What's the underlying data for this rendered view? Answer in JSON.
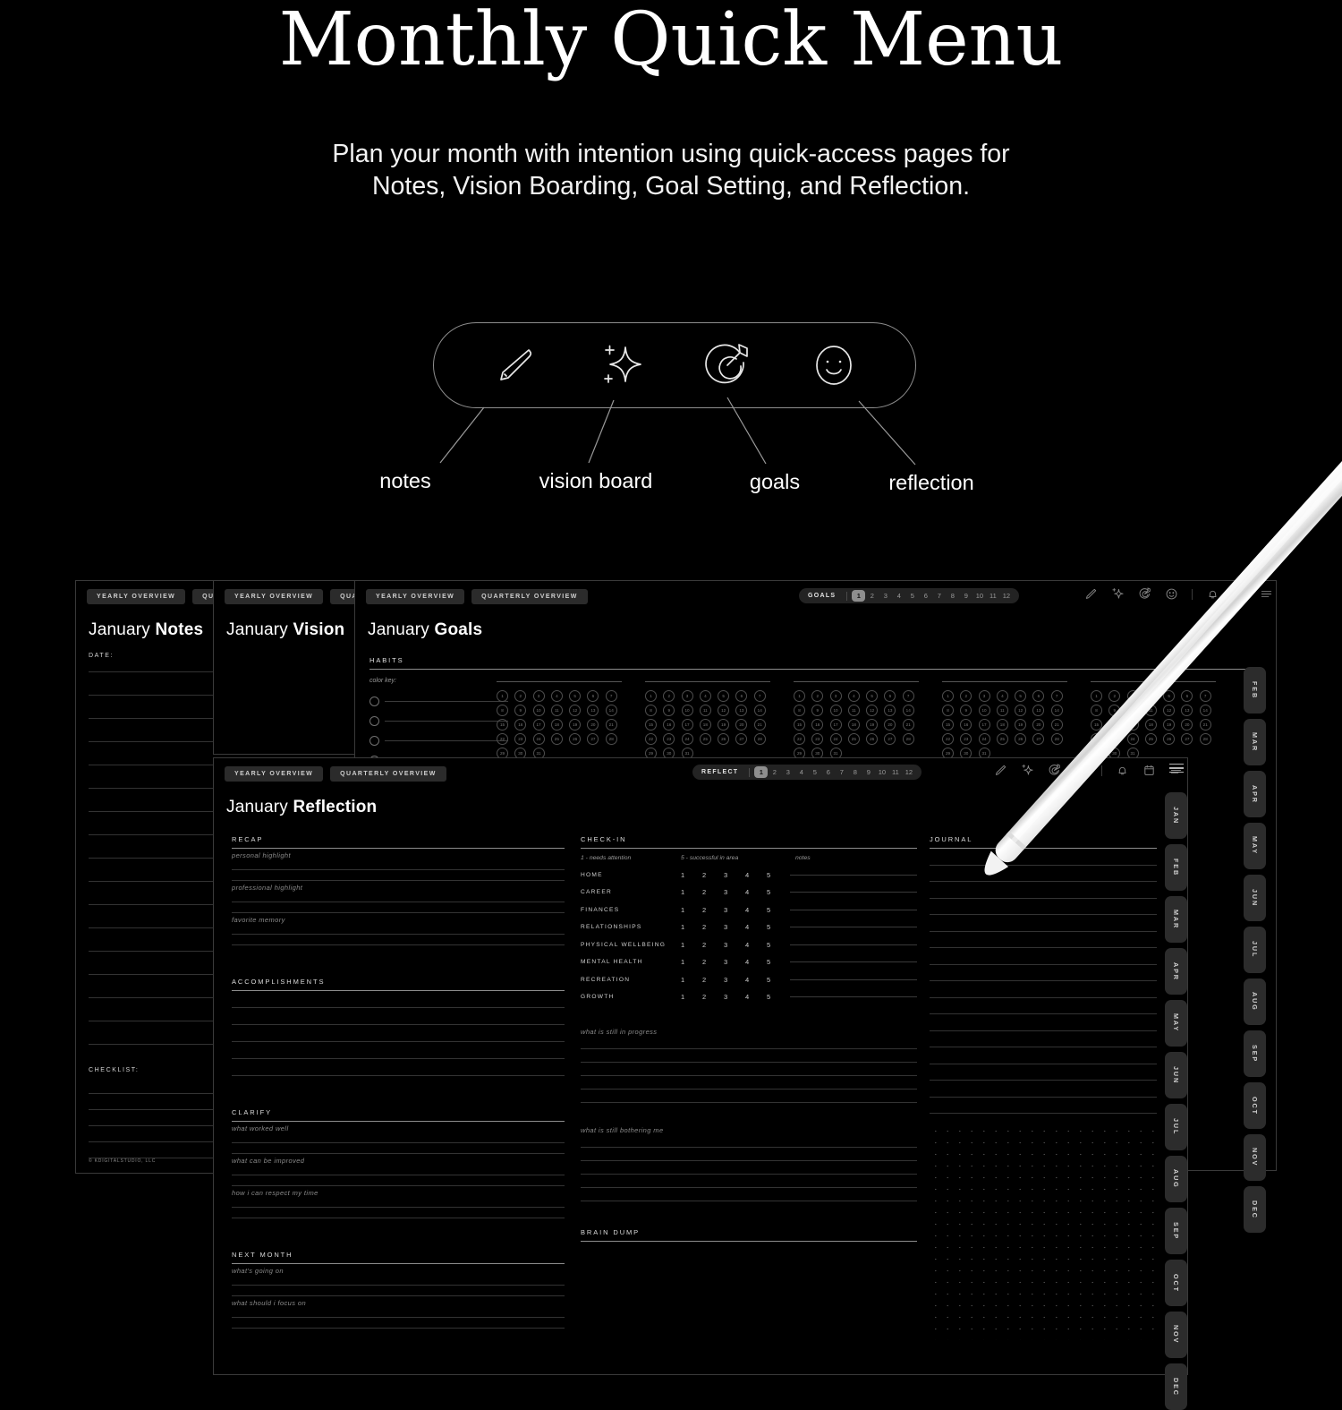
{
  "header": {
    "title": "Monthly Quick Menu",
    "subtitle_line1": "Plan your month with intention using quick-access pages for",
    "subtitle_line2": "Notes, Vision Boarding, Goal Setting, and Reflection."
  },
  "quick_menu": {
    "items": [
      {
        "icon": "pencil-icon",
        "label": "notes"
      },
      {
        "icon": "sparkle-icon",
        "label": "vision board"
      },
      {
        "icon": "target-icon",
        "label": "goals"
      },
      {
        "icon": "smiley-icon",
        "label": "reflection"
      }
    ]
  },
  "nav_chips": {
    "yearly": "YEARLY OVERVIEW",
    "quarterly": "QUARTERLY OVERVIEW",
    "quarterly_short": "QUARTER"
  },
  "pages": {
    "notes": {
      "month": "January",
      "name": "Notes",
      "date_label": "DATE:",
      "checklist_label": "CHECKLIST:",
      "copyright": "© KDIGITALSTUDIO, LLC"
    },
    "vision": {
      "month": "January",
      "name": "Vision"
    },
    "goals": {
      "month": "January",
      "name": "Goals",
      "habits_label": "HABITS",
      "color_key": "color key:"
    },
    "reflect": {
      "month": "January",
      "name": "Reflection"
    }
  },
  "switchers": {
    "goals": {
      "name": "GOALS",
      "numbers": [
        "1",
        "2",
        "3",
        "4",
        "5",
        "6",
        "7",
        "8",
        "9",
        "10",
        "11",
        "12"
      ],
      "active": "1"
    },
    "reflect": {
      "name": "REFLECT",
      "numbers": [
        "1",
        "2",
        "3",
        "4",
        "5",
        "6",
        "7",
        "8",
        "9",
        "10",
        "11",
        "12"
      ],
      "active": "1"
    }
  },
  "toolbar_icons": [
    "pencil-icon",
    "sparkle-icon",
    "target-icon",
    "smiley-icon",
    "divider",
    "bell-icon",
    "calendar-icon",
    "menu-icon"
  ],
  "reflection": {
    "recap": {
      "label": "RECAP",
      "fields": [
        "personal highlight",
        "professional highlight",
        "favorite memory"
      ]
    },
    "accomplishments": {
      "label": "ACCOMPLISHMENTS",
      "lines": 5
    },
    "clarify": {
      "label": "CLARIFY",
      "fields": [
        "what worked well",
        "what can be improved",
        "how i can respect my time"
      ]
    },
    "next_month": {
      "label": "NEXT MONTH",
      "fields": [
        "what's going on",
        "what should i focus on"
      ]
    },
    "checkin": {
      "label": "CHECK-IN",
      "legend_low": "1 - needs attention",
      "legend_high": "5 - successful in area",
      "legend_notes": "notes",
      "scale": [
        "1",
        "2",
        "3",
        "4",
        "5"
      ],
      "areas": [
        "HOME",
        "CAREER",
        "FINANCES",
        "RELATIONSHIPS",
        "PHYSICAL WELLBEING",
        "MENTAL HEALTH",
        "RECREATION",
        "GROWTH"
      ]
    },
    "progress": {
      "prompt": "what is still in progress"
    },
    "bothering": {
      "prompt": "what is still bothering me"
    },
    "brain_dump": {
      "label": "BRAIN DUMP"
    },
    "journal": {
      "label": "JOURNAL"
    }
  },
  "month_rails": {
    "back": [
      "FEB",
      "MAR",
      "APR",
      "MAY",
      "JUN",
      "JUL",
      "AUG",
      "SEP",
      "OCT",
      "NOV",
      "DEC"
    ],
    "front": [
      "JAN",
      "FEB",
      "MAR",
      "APR",
      "MAY",
      "JUN",
      "JUL",
      "AUG",
      "SEP",
      "OCT",
      "NOV",
      "DEC"
    ]
  },
  "habits": {
    "days": 31,
    "blocks": 5
  },
  "colors": {
    "background": "#000000",
    "text": "#ffffff",
    "chip": "#2b2b2b",
    "rule": "#333333",
    "accent": "#8e8e8e"
  }
}
